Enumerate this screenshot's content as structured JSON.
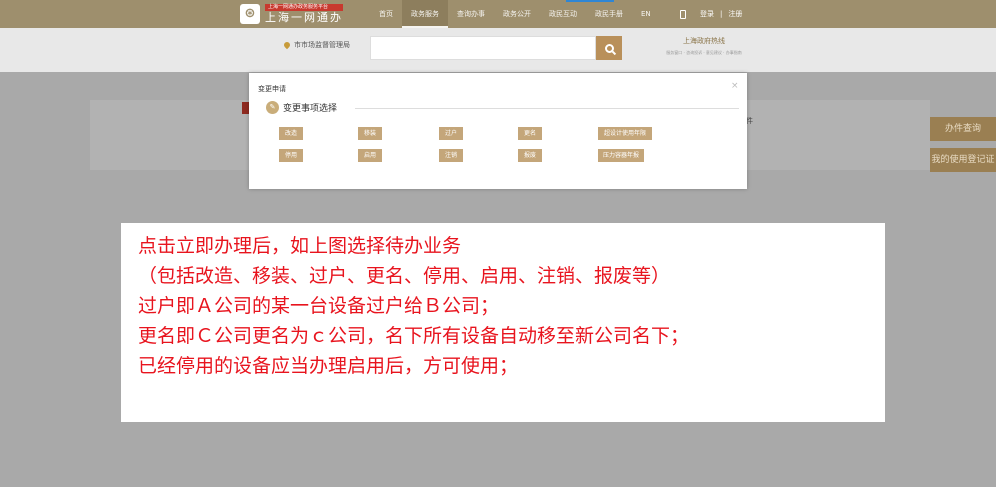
{
  "header": {
    "logo_tagline": "上海一网通办政务服务平台",
    "logo_name": "上海一网通办",
    "nav": [
      "首页",
      "政务服务",
      "查询办事",
      "政务公开",
      "政民互动",
      "政民手册",
      "EN"
    ],
    "login": "登录",
    "register": "注册",
    "colors": {
      "bar": "#9e8f6d",
      "accent": "#2f86d4"
    }
  },
  "searchbar": {
    "location": "市市场监督管理局",
    "placeholder": "",
    "hotline_title": "上海政府热线",
    "hotline_sub": "服务窗口 · 咨询投诉 · 意见建议 · 办事指南"
  },
  "background_page": {
    "side_buttons": [
      "办件查询",
      "我的使用登记证"
    ],
    "fragment": "件"
  },
  "modal": {
    "title": "变更申请",
    "close": "×",
    "section_title": "变更事项选择",
    "options_row1": [
      "改造",
      "移装",
      "过户",
      "更名",
      "超设计使用年限"
    ],
    "options_row2": [
      "停用",
      "启用",
      "注销",
      "报废",
      "压力容器年报"
    ],
    "button_color": "#c4a67a"
  },
  "note": {
    "lines": [
      "点击立即办理后，如上图选择待办业务",
      "（包括改造、移装、过户、更名、停用、启用、注销、报废等）",
      "过户即Ａ公司的某一台设备过户给Ｂ公司；",
      "更名即Ｃ公司更名为ｃ公司，名下所有设备自动移至新公司名下；",
      "已经停用的设备应当办理启用后，方可使用；"
    ],
    "text_color": "#e8141e"
  }
}
